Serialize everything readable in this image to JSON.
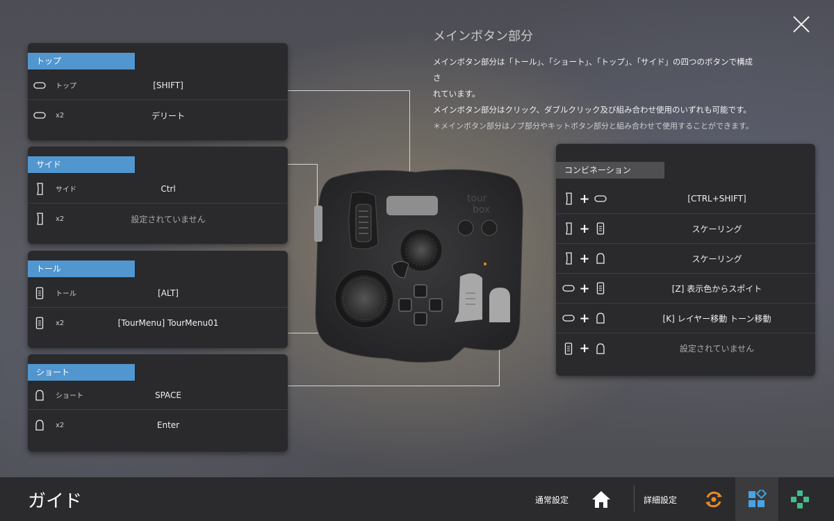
{
  "description": {
    "title": "メインボタン部分",
    "line1": "メインボタン部分は「トール」、「ショート」、「トップ」、「サイド」の四つのボタンで構成さ",
    "line2": "れています。",
    "line3": "メインボタン部分はクリック、ダブルクリック及び組み合わせ使用のいずれも可能です。",
    "note": "＊メインボタン部分はノブ部分やキットボタン部分と組み合わせて使用することができます。"
  },
  "panels": {
    "top": {
      "tag": "トップ",
      "rows": [
        {
          "icon": "top-button-icon",
          "sub": "トップ",
          "value": "[SHIFT]"
        },
        {
          "icon": "top-button-icon",
          "sub": "x2",
          "value": "デリート"
        }
      ]
    },
    "side": {
      "tag": "サイド",
      "rows": [
        {
          "icon": "side-button-icon",
          "sub": "サイド",
          "value": "Ctrl"
        },
        {
          "icon": "side-button-icon",
          "sub": "x2",
          "value": "設定されていません"
        }
      ]
    },
    "tall": {
      "tag": "トール",
      "rows": [
        {
          "icon": "tall-button-icon",
          "sub": "トール",
          "value": "[ALT]"
        },
        {
          "icon": "tall-button-icon",
          "sub": "x2",
          "value": "[TourMenu] TourMenu01"
        }
      ]
    },
    "short": {
      "tag": "ショート",
      "rows": [
        {
          "icon": "short-button-icon",
          "sub": "ショート",
          "value": "SPACE"
        },
        {
          "icon": "short-button-icon",
          "sub": "x2",
          "value": "Enter"
        }
      ]
    }
  },
  "combination": {
    "tag": "コンビネーション",
    "rows": [
      {
        "a": "side-button-icon",
        "b": "top-button-icon",
        "plus": "+",
        "value": "[CTRL+SHIFT]"
      },
      {
        "a": "side-button-icon",
        "b": "tall-button-icon",
        "plus": "+",
        "value": "スケーリング"
      },
      {
        "a": "side-button-icon",
        "b": "short-button-icon",
        "plus": "+",
        "value": "スケーリング"
      },
      {
        "a": "top-button-icon",
        "b": "tall-button-icon",
        "plus": "+",
        "value": "[Z] 表示色からスポイト"
      },
      {
        "a": "top-button-icon",
        "b": "short-button-icon",
        "plus": "+",
        "value": "[K] レイヤー移動 トーン移動"
      },
      {
        "a": "tall-button-icon",
        "b": "short-button-icon",
        "plus": "+",
        "value": "設定されていません"
      }
    ]
  },
  "device": {
    "logo_line1": "tour",
    "logo_line2": "box"
  },
  "footer": {
    "title": "ガイド",
    "normal_settings": "通常設定",
    "advanced_settings": "詳細設定"
  },
  "colors": {
    "accent_blue": "#5296cf",
    "accent_orange": "#f08a24",
    "accent_green": "#3dbf8c",
    "panel_bg": "#2a2a2c",
    "footer_bg": "#2b2b2d"
  }
}
